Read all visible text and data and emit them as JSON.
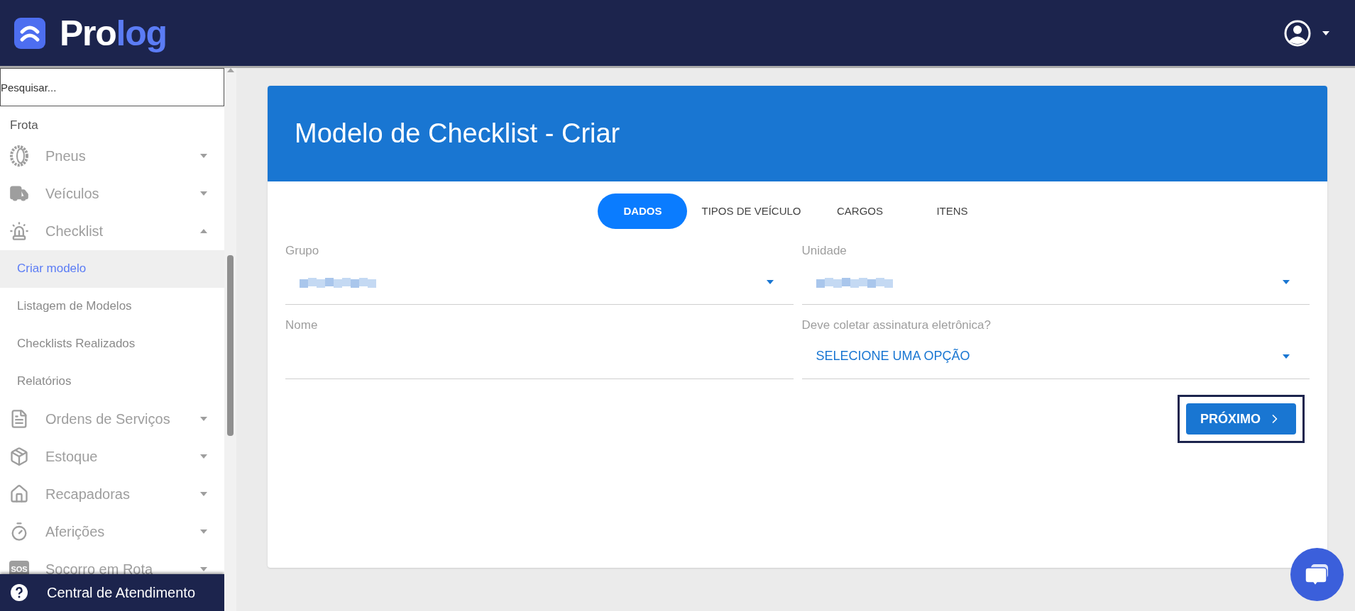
{
  "logo": {
    "part_a": "Pro",
    "part_b": "log"
  },
  "sidebar": {
    "search": {
      "placeholder": "Pesquisar..."
    },
    "section": "Frota",
    "items": [
      {
        "label": "Pneus",
        "expanded": false
      },
      {
        "label": "Veículos",
        "expanded": false
      },
      {
        "label": "Checklist",
        "expanded": true,
        "children": [
          {
            "label": "Criar modelo",
            "selected": true
          },
          {
            "label": "Listagem de Modelos",
            "selected": false
          },
          {
            "label": "Checklists Realizados",
            "selected": false
          },
          {
            "label": "Relatórios",
            "selected": false
          }
        ]
      },
      {
        "label": "Ordens de Serviços",
        "expanded": false
      },
      {
        "label": "Estoque",
        "expanded": false
      },
      {
        "label": "Recapadoras",
        "expanded": false
      },
      {
        "label": "Aferições",
        "expanded": false
      },
      {
        "label": "Socorro em Rota",
        "expanded": false,
        "icon_label": "SOS"
      }
    ],
    "help": "Central de Atendimento"
  },
  "card": {
    "title": "Modelo de Checklist - Criar",
    "tabs": [
      {
        "label": "DADOS",
        "selected": true
      },
      {
        "label": "TIPOS DE VEÍCULO",
        "selected": false
      },
      {
        "label": "CARGOS",
        "selected": false
      },
      {
        "label": "ITENS",
        "selected": false
      }
    ],
    "fields": [
      {
        "kind": "blurred-select",
        "label": "Grupo"
      },
      {
        "kind": "blurred-select",
        "label": "Unidade"
      },
      {
        "kind": "text",
        "label": "Nome"
      },
      {
        "kind": "select",
        "label": "Deve coletar assinatura eletrônica?",
        "value": "SELECIONE UMA OPÇÃO"
      }
    ],
    "next_button": {
      "label": "PRÓXIMO",
      "focused": true
    }
  }
}
